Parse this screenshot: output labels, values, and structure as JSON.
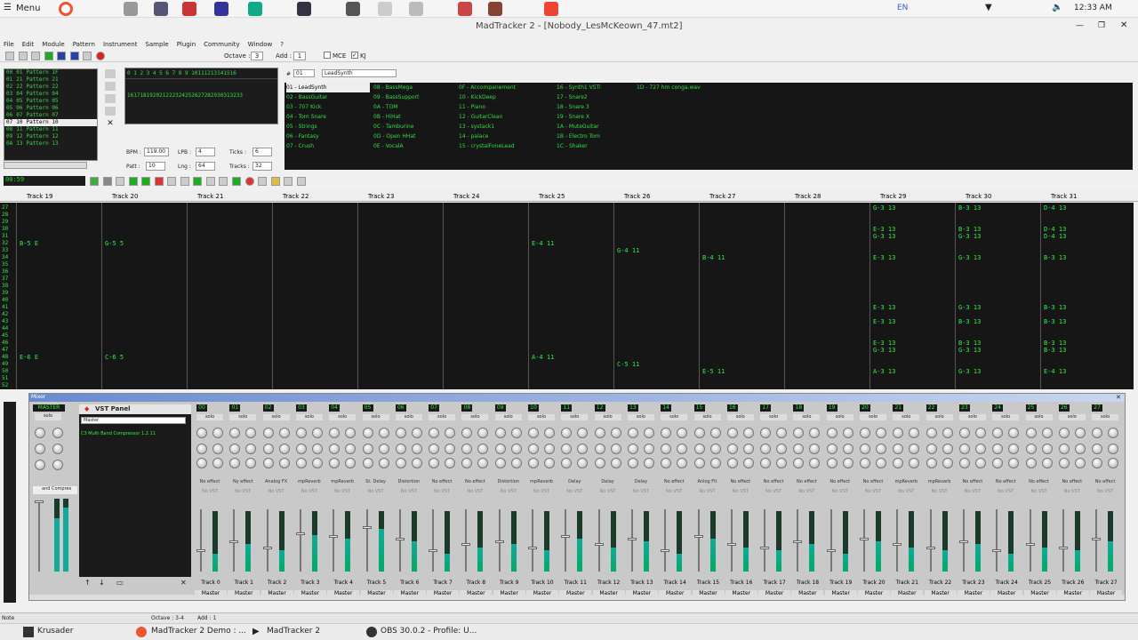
{
  "topbar": {
    "menu": "Menu",
    "lang": "EN",
    "time": "12:33 AM"
  },
  "window": {
    "title": "MadTracker 2 - [Nobody_LesMcKeown_47.mt2]"
  },
  "menubar": [
    "File",
    "Edit",
    "Module",
    "Pattern",
    "Instrument",
    "Sample",
    "Plugin",
    "Community",
    "Window",
    "?"
  ],
  "toolbar": {
    "octave_label": "Octave :",
    "octave": "3",
    "add_label": "Add :",
    "add": "1",
    "mce": "MCE",
    "kj": "KJ"
  },
  "patterns": [
    {
      "num": "00",
      "id": "01",
      "name": "Pattern 1F"
    },
    {
      "num": "01",
      "id": "21",
      "name": "Pattern 21"
    },
    {
      "num": "02",
      "id": "22",
      "name": "Pattern 22"
    },
    {
      "num": "03",
      "id": "04",
      "name": "Pattern 04"
    },
    {
      "num": "04",
      "id": "05",
      "name": "Pattern 05"
    },
    {
      "num": "05",
      "id": "06",
      "name": "Pattern 06"
    },
    {
      "num": "06",
      "id": "07",
      "name": "Pattern 07"
    },
    {
      "num": "07",
      "id": "10",
      "name": "Pattern 10"
    },
    {
      "num": "08",
      "id": "11",
      "name": "Pattern 11"
    },
    {
      "num": "09",
      "id": "12",
      "name": "Pattern 12"
    },
    {
      "num": "0A",
      "id": "13",
      "name": "Pattern 13"
    }
  ],
  "order_row1": "0 1 2 3 4 5 6 7 8 9 10111213141516",
  "order_row2": "161718192021222324252627282930313233",
  "song": {
    "bpm_label": "BPM :",
    "bpm": "119.00",
    "lpb_label": "LPB :",
    "lpb": "4",
    "ticks_label": "Ticks :",
    "ticks": "6",
    "patt_label": "Patt :",
    "patt": "10",
    "lng_label": "Lng :",
    "lng": "64",
    "tracks_label": "Tracks :",
    "tracks": "32"
  },
  "instrument": {
    "num_label": "#",
    "num": "01",
    "name": "LeadSynth"
  },
  "instruments_col1": [
    "01 - LeadSynth",
    "02 - BassGuitar",
    "03 - 707 Kick",
    "04 - Tom Snare",
    "05 - Strings",
    "06 - Fantasy",
    "07 - Crush"
  ],
  "instruments_col2": [
    "08 - BassMega",
    "09 - BassSupport",
    "0A - TOM",
    "0B - HiHat",
    "0C - Tamburine",
    "0D - Open HHat",
    "0E - VocalA"
  ],
  "instruments_col3": [
    "0F - Accompanement",
    "10 - KickDeep",
    "11 - Piano",
    "12 - GuitarClean",
    "13 - systack1",
    "14 - palace",
    "15 - crystalFoneLead"
  ],
  "instruments_col4": [
    "16 - Synth1 VSTi",
    "17 - Snare2",
    "18 - Snare 3",
    "19 - Snare X",
    "1A - MuteGuitar",
    "1B - Electro Tom",
    "1C - Shaker"
  ],
  "instruments_col5": [
    "1D - 727 hm conga.wav"
  ],
  "position": "00:59",
  "track_headers": [
    "Track 19",
    "Track 20",
    "Track 21",
    "Track 22",
    "Track 23",
    "Track 24",
    "Track 25",
    "Track 26",
    "Track 27",
    "Track 28",
    "Track 29",
    "Track 30",
    "Track 31"
  ],
  "row_numbers": [
    "27",
    "28",
    "29",
    "30",
    "31",
    "32",
    "33",
    "34",
    "35",
    "36",
    "37",
    "38",
    "39",
    "40",
    "41",
    "42",
    "43",
    "44",
    "45",
    "46",
    "47",
    "48",
    "49",
    "50",
    "51",
    "52"
  ],
  "notes": [
    {
      "text": "B-5  E",
      "col": 0,
      "row": 5
    },
    {
      "text": "E-6  E",
      "col": 0,
      "row": 21
    },
    {
      "text": "G-5  5",
      "col": 1,
      "row": 5
    },
    {
      "text": "C-6  5",
      "col": 1,
      "row": 21
    },
    {
      "text": "E-4 11",
      "col": 6,
      "row": 5
    },
    {
      "text": "A-4 11",
      "col": 6,
      "row": 21
    },
    {
      "text": "G-4 11",
      "col": 7,
      "row": 6
    },
    {
      "text": "C-5 11",
      "col": 7,
      "row": 22
    },
    {
      "text": "B-4 11",
      "col": 8,
      "row": 7
    },
    {
      "text": "E-5 11",
      "col": 8,
      "row": 23
    },
    {
      "text": "G-3 13",
      "col": 10,
      "row": 0
    },
    {
      "text": "E-3 13",
      "col": 10,
      "row": 3
    },
    {
      "text": "G-3 13",
      "col": 10,
      "row": 4
    },
    {
      "text": "E-3 13",
      "col": 10,
      "row": 7
    },
    {
      "text": "E-3 13",
      "col": 10,
      "row": 14
    },
    {
      "text": "E-3 13",
      "col": 10,
      "row": 16
    },
    {
      "text": "E-3 13",
      "col": 10,
      "row": 19
    },
    {
      "text": "G-3 13",
      "col": 10,
      "row": 20
    },
    {
      "text": "A-3 13",
      "col": 10,
      "row": 23
    },
    {
      "text": "B-3 13",
      "col": 11,
      "row": 0
    },
    {
      "text": "B-3 13",
      "col": 11,
      "row": 3
    },
    {
      "text": "G-3 13",
      "col": 11,
      "row": 4
    },
    {
      "text": "G-3 13",
      "col": 11,
      "row": 7
    },
    {
      "text": "G-3 13",
      "col": 11,
      "row": 14
    },
    {
      "text": "B-3 13",
      "col": 11,
      "row": 16
    },
    {
      "text": "B-3 13",
      "col": 11,
      "row": 19
    },
    {
      "text": "G-3 13",
      "col": 11,
      "row": 20
    },
    {
      "text": "G-3 13",
      "col": 11,
      "row": 23
    },
    {
      "text": "D-4 13",
      "col": 12,
      "row": 0
    },
    {
      "text": "D-4 13",
      "col": 12,
      "row": 3
    },
    {
      "text": "D-4 13",
      "col": 12,
      "row": 4
    },
    {
      "text": "B-3 13",
      "col": 12,
      "row": 7
    },
    {
      "text": "B-3 13",
      "col": 12,
      "row": 14
    },
    {
      "text": "B-3 13",
      "col": 12,
      "row": 16
    },
    {
      "text": "B-3 13",
      "col": 12,
      "row": 19
    },
    {
      "text": "B-3 13",
      "col": 12,
      "row": 20
    },
    {
      "text": "E-4 13",
      "col": 12,
      "row": 23
    }
  ],
  "mixer": {
    "title": "Mixer",
    "master_label": "MASTER",
    "vst_panel": "VST Panel",
    "master_select": "Master",
    "vst_plugin": "C3 Multi Band Compressor 1.2.11",
    "side_plugin": "and Compres",
    "solo": "solo",
    "no_effect": "No effect",
    "no_vst": "No VST",
    "channels": [
      {
        "num": "00",
        "name": "Track 0",
        "fx": "No effect",
        "level": 0.3
      },
      {
        "num": "01",
        "name": "Track 1",
        "fx": "Ny effect",
        "level": 0.45
      },
      {
        "num": "02",
        "name": "Track 2",
        "fx": "Analog FX",
        "level": 0.35
      },
      {
        "num": "03",
        "name": "Track 3",
        "fx": "mpReverb",
        "level": 0.6
      },
      {
        "num": "04",
        "name": "Track 4",
        "fx": "mpReverb",
        "level": 0.55
      },
      {
        "num": "05",
        "name": "Track 5",
        "fx": "St. Delay",
        "level": 0.7
      },
      {
        "num": "06",
        "name": "Track 6",
        "fx": "Distortion",
        "level": 0.5
      },
      {
        "num": "07",
        "name": "Track 7",
        "fx": "No effect",
        "level": 0.3
      },
      {
        "num": "08",
        "name": "Track 8",
        "fx": "No effect",
        "level": 0.4
      },
      {
        "num": "09",
        "name": "Track 9",
        "fx": "Distortion",
        "level": 0.45
      },
      {
        "num": "10",
        "name": "Track 10",
        "fx": "mpReverb",
        "level": 0.35
      },
      {
        "num": "11",
        "name": "Track 11",
        "fx": "Delay",
        "level": 0.55
      },
      {
        "num": "12",
        "name": "Track 12",
        "fx": "Delay",
        "level": 0.4
      },
      {
        "num": "13",
        "name": "Track 13",
        "fx": "Delay",
        "level": 0.5
      },
      {
        "num": "14",
        "name": "Track 14",
        "fx": "No effect",
        "level": 0.3
      },
      {
        "num": "15",
        "name": "Track 15",
        "fx": "Anlog Flt",
        "level": 0.55
      },
      {
        "num": "16",
        "name": "Track 16",
        "fx": "No effect",
        "level": 0.4
      },
      {
        "num": "17",
        "name": "Track 17",
        "fx": "No effect",
        "level": 0.35
      },
      {
        "num": "18",
        "name": "Track 18",
        "fx": "No effect",
        "level": 0.45
      },
      {
        "num": "19",
        "name": "Track 19",
        "fx": "No effect",
        "level": 0.3
      },
      {
        "num": "20",
        "name": "Track 20",
        "fx": "No effect",
        "level": 0.5
      },
      {
        "num": "21",
        "name": "Track 21",
        "fx": "mpReverb",
        "level": 0.4
      },
      {
        "num": "22",
        "name": "Track 22",
        "fx": "mpReverb",
        "level": 0.35
      },
      {
        "num": "23",
        "name": "Track 23",
        "fx": "No effect",
        "level": 0.45
      },
      {
        "num": "24",
        "name": "Track 24",
        "fx": "No effect",
        "level": 0.3
      },
      {
        "num": "25",
        "name": "Track 25",
        "fx": "No effect",
        "level": 0.4
      },
      {
        "num": "26",
        "name": "Track 26",
        "fx": "No effect",
        "level": 0.35
      },
      {
        "num": "27",
        "name": "Track 27",
        "fx": "No effect",
        "level": 0.5
      }
    ],
    "out": "Master"
  },
  "status": {
    "note": "Note",
    "octave": "Octave : 3-4",
    "add": "Add : 1"
  },
  "taskbar": {
    "t1": "Krusader",
    "t2": "MadTracker 2 Demo : ...",
    "t3": "MadTracker 2",
    "t4": "OBS 30.0.2 - Profile: U..."
  }
}
